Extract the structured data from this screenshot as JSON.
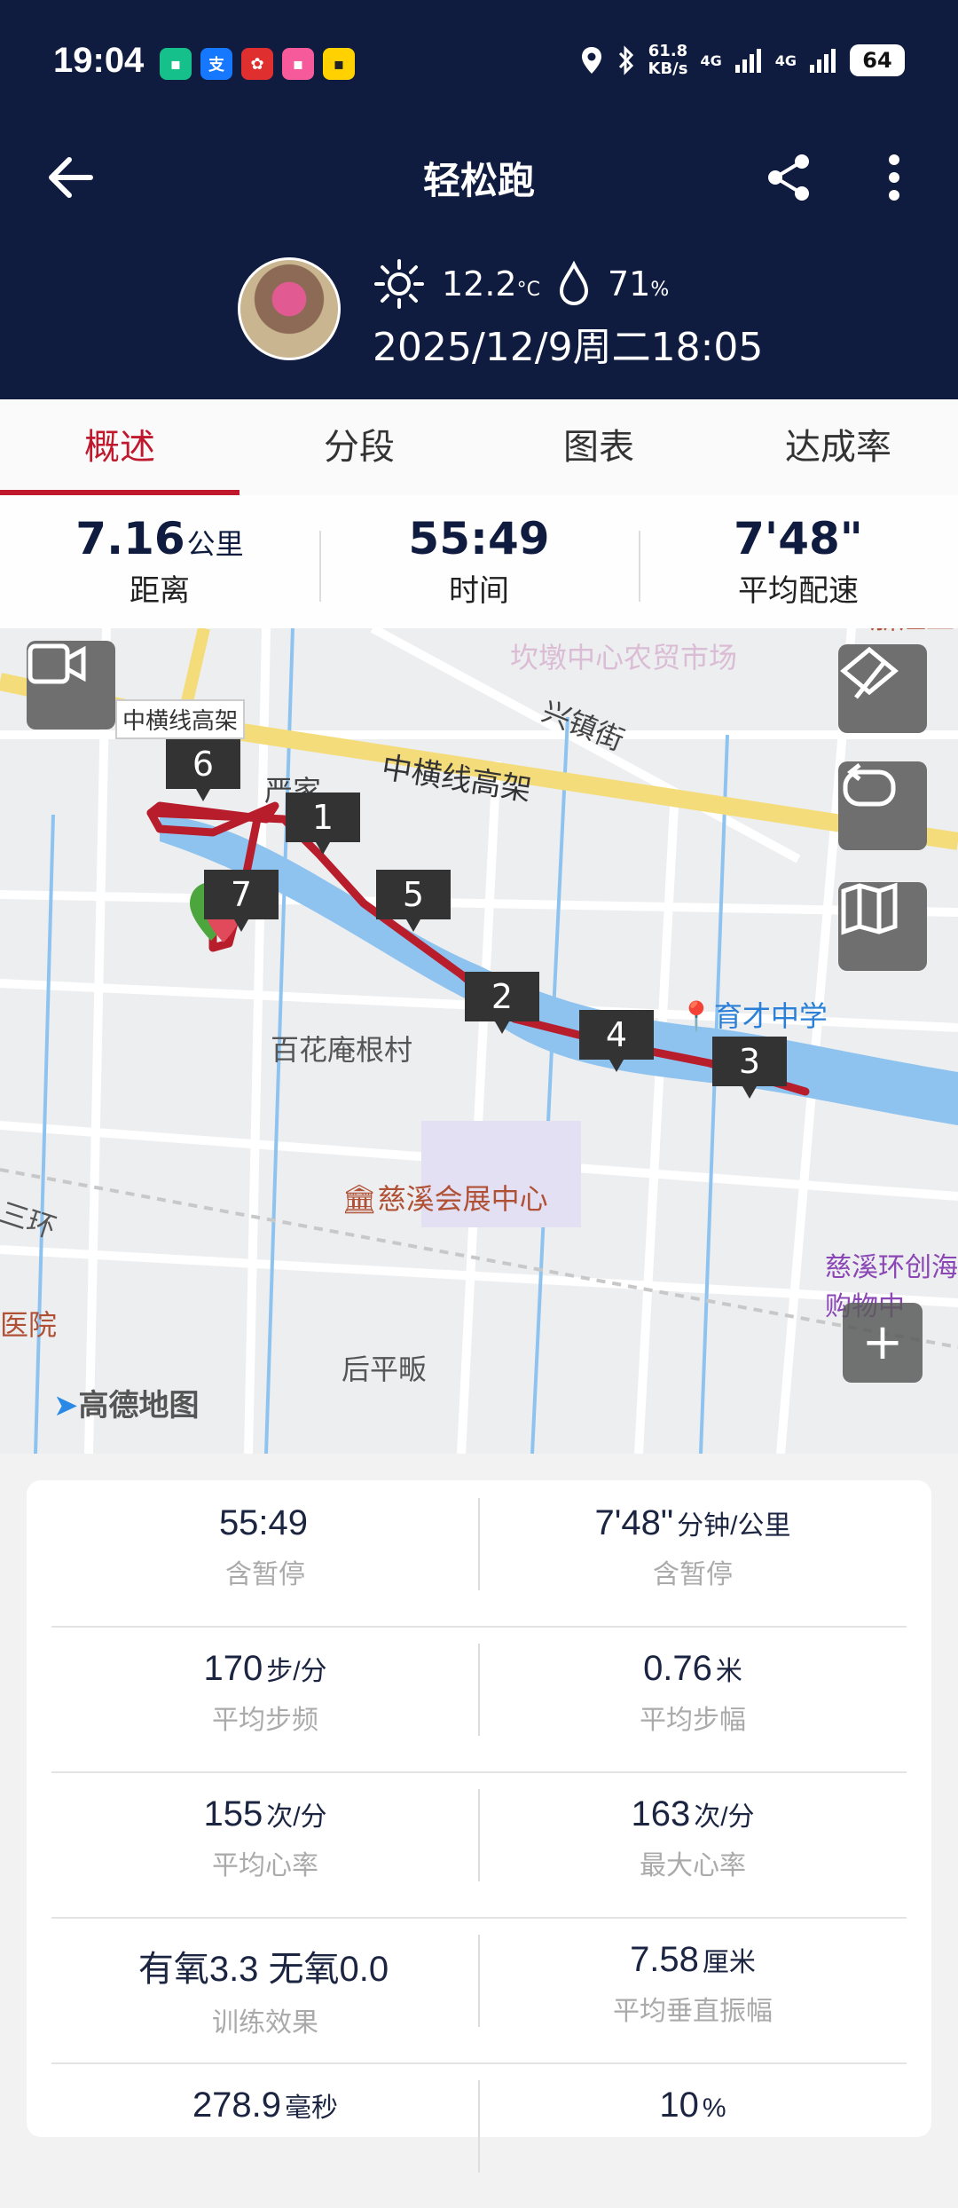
{
  "status_bar": {
    "time": "19:04",
    "net_speed_value": "61.8",
    "net_speed_unit": "KB/s",
    "signal1": "4G",
    "signal2": "4G",
    "battery": "64"
  },
  "nav": {
    "title": "轻松跑"
  },
  "weather": {
    "temperature": "12.2",
    "temp_unit": "°C",
    "humidity": "71",
    "humidity_unit": "%",
    "datetime": "2025/12/9周二18:05"
  },
  "tabs": [
    "概述",
    "分段",
    "图表",
    "达成率"
  ],
  "summary": [
    {
      "value": "7.16",
      "unit": "公里",
      "label": "距离"
    },
    {
      "value": "55:49",
      "unit": "",
      "label": "时间"
    },
    {
      "value": "7'48\"",
      "unit": "",
      "label": "平均配速"
    }
  ],
  "map": {
    "labels": {
      "highway_tag": "中横线高架",
      "highway": "中横线高架",
      "street": "兴镇街",
      "yanjia": "严家",
      "village": "百花庵根村",
      "school": "育才中学",
      "expo": "慈溪会展中心",
      "mall": "慈溪环创海购物中",
      "houping": "后平畈",
      "hospital": "医院",
      "kandun": "坎墩中心农贸市场",
      "zhejiang": "浙江工",
      "ring": "三环",
      "logo": "高德地图"
    },
    "markers": [
      "1",
      "2",
      "3",
      "4",
      "5",
      "6",
      "7"
    ],
    "route_color": "#b81d2c",
    "zoom_label": "+"
  },
  "stats": [
    {
      "left": {
        "value": "55:49",
        "unit": "",
        "label": "含暂停"
      },
      "right": {
        "value": "7'48\"",
        "unit": "分钟/公里",
        "label": "含暂停"
      }
    },
    {
      "left": {
        "value": "170",
        "unit": "步/分",
        "label": "平均步频"
      },
      "right": {
        "value": "0.76",
        "unit": "米",
        "label": "平均步幅"
      }
    },
    {
      "left": {
        "value": "155",
        "unit": "次/分",
        "label": "平均心率"
      },
      "right": {
        "value": "163",
        "unit": "次/分",
        "label": "最大心率"
      }
    },
    {
      "left": {
        "value": "有氧3.3 无氧0.0",
        "unit": "",
        "label": "训练效果"
      },
      "right": {
        "value": "7.58",
        "unit": "厘米",
        "label": "平均垂直振幅"
      }
    },
    {
      "left": {
        "value": "278.9",
        "unit": "毫秒",
        "label": ""
      },
      "right": {
        "value": "10",
        "unit": "%",
        "label": ""
      }
    }
  ],
  "colors": {
    "header_bg": "#0f1c3f",
    "accent": "#c0192e",
    "route": "#b81d2c"
  }
}
